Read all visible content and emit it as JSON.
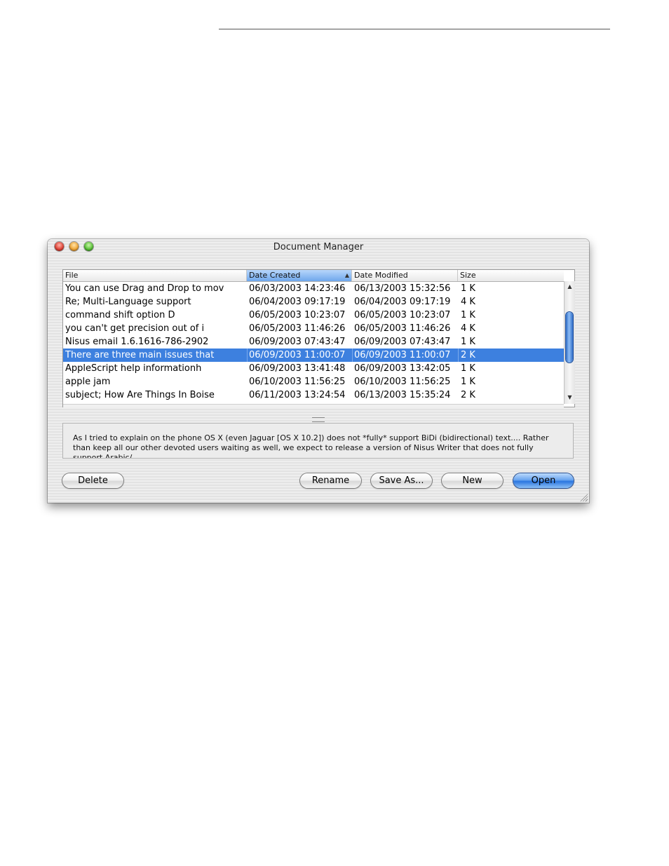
{
  "window": {
    "title": "Document Manager"
  },
  "table": {
    "columns": [
      {
        "label": "File"
      },
      {
        "label": "Date Created",
        "sorted": true
      },
      {
        "label": "Date Modified"
      },
      {
        "label": "Size"
      }
    ],
    "rows": [
      {
        "file": "You can use Drag and Drop to mov",
        "created": "06/03/2003 14:23:46",
        "modified": "06/13/2003 15:32:56",
        "size": "1 K"
      },
      {
        "file": "Re; Multi-Language support",
        "created": "06/04/2003 09:17:19",
        "modified": "06/04/2003 09:17:19",
        "size": "4 K"
      },
      {
        "file": "command shift option D",
        "created": "06/05/2003 10:23:07",
        "modified": "06/05/2003 10:23:07",
        "size": "1 K"
      },
      {
        "file": "you can't get precision out of i",
        "created": "06/05/2003 11:46:26",
        "modified": "06/05/2003 11:46:26",
        "size": "4 K"
      },
      {
        "file": "Nisus email 1.6.1616-786-2902",
        "created": "06/09/2003 07:43:47",
        "modified": "06/09/2003 07:43:47",
        "size": "1 K"
      },
      {
        "file": "There are three main issues that",
        "created": "06/09/2003 11:00:07",
        "modified": "06/09/2003 11:00:07",
        "size": "2 K",
        "selected": true
      },
      {
        "file": "AppleScript help informationh",
        "created": "06/09/2003 13:41:48",
        "modified": "06/09/2003 13:42:05",
        "size": "1 K"
      },
      {
        "file": "apple jam",
        "created": "06/10/2003 11:56:25",
        "modified": "06/10/2003 11:56:25",
        "size": "1 K"
      },
      {
        "file": "subject; How Are Things In Boise",
        "created": "06/11/2003 13:24:54",
        "modified": "06/13/2003 15:35:24",
        "size": "2 K"
      }
    ]
  },
  "preview": {
    "text": "As I tried to explain on the phone OS X (even Jaguar [OS X 10.2]) does not *fully* support BiDi (bidirectional) text....  Rather than keep all our other devoted users waiting as well, we expect to release a version of Nisus Writer that does not fully support Arabic/"
  },
  "buttons": {
    "delete": "Delete",
    "rename": "Rename",
    "save_as": "Save As...",
    "new": "New",
    "open": "Open"
  },
  "icons": {
    "close": "close-icon",
    "minimize": "minimize-icon",
    "zoom": "zoom-icon",
    "sort": "sort-ascending-icon",
    "scroll_up": "scroll-up-arrow-icon",
    "scroll_down": "scroll-down-arrow-icon",
    "resize": "resize-grip-icon"
  },
  "colors": {
    "selection": "#3d80df",
    "default_button": "#2b76e0"
  }
}
